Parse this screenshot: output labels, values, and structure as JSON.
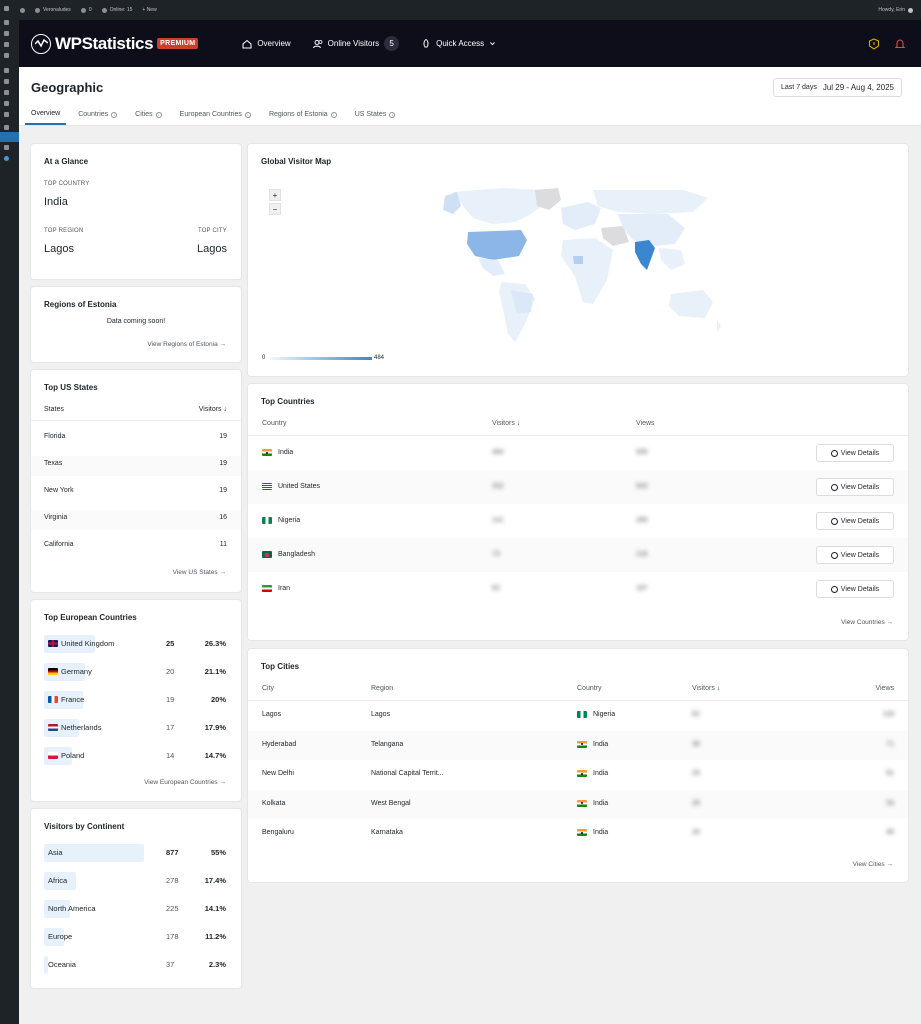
{
  "adminbar": {
    "site_name": "Veronaludes",
    "comments": "0",
    "online": "Online: 15",
    "new_label": "+ New",
    "howdy": "Howdy, Erin"
  },
  "header": {
    "logo_text": "WPStatistics",
    "premium": "PREMIUM",
    "nav": {
      "overview": "Overview",
      "online_visitors": "Online Visitors",
      "online_count": "5",
      "quick_access": "Quick Access"
    }
  },
  "page": {
    "title": "Geographic",
    "date_preset": "Last 7 days",
    "date_range": "Jul 29 - Aug 4, 2025",
    "tabs": [
      "Overview",
      "Countries",
      "Cities",
      "European Countries",
      "Regions of Estonia",
      "US States"
    ]
  },
  "glance": {
    "title": "At a Glance",
    "top_country_label": "TOP COUNTRY",
    "top_country": "India",
    "top_region_label": "TOP REGION",
    "top_region": "Lagos",
    "top_city_label": "TOP CITY",
    "top_city": "Lagos"
  },
  "estonia": {
    "title": "Regions of Estonia",
    "message": "Data coming soon!",
    "link": "View Regions of Estonia →"
  },
  "us_states": {
    "title": "Top US States",
    "col_state": "States",
    "col_visitors": "Visitors ↓",
    "rows": [
      {
        "name": "Florida",
        "value": "19"
      },
      {
        "name": "Texas",
        "value": "19"
      },
      {
        "name": "New York",
        "value": "19"
      },
      {
        "name": "Virginia",
        "value": "16"
      },
      {
        "name": "California",
        "value": "11"
      }
    ],
    "link": "View US States →"
  },
  "european": {
    "title": "Top European Countries",
    "rows": [
      {
        "name": "United Kingdom",
        "visitors": "25",
        "percent": "26.3%",
        "share": 0.263,
        "flag": "gb"
      },
      {
        "name": "Germany",
        "visitors": "20",
        "percent": "21.1%",
        "share": 0.211,
        "flag": "de"
      },
      {
        "name": "France",
        "visitors": "19",
        "percent": "20%",
        "share": 0.2,
        "flag": "fr"
      },
      {
        "name": "Netherlands",
        "visitors": "17",
        "percent": "17.9%",
        "share": 0.179,
        "flag": "nl"
      },
      {
        "name": "Poland",
        "visitors": "14",
        "percent": "14.7%",
        "share": 0.147,
        "flag": "pl"
      }
    ],
    "link": "View European Countries →"
  },
  "continents": {
    "title": "Visitors by Continent",
    "rows": [
      {
        "name": "Asia",
        "visitors": "877",
        "percent": "55%",
        "share": 0.55
      },
      {
        "name": "Africa",
        "visitors": "278",
        "percent": "17.4%",
        "share": 0.174
      },
      {
        "name": "North America",
        "visitors": "225",
        "percent": "14.1%",
        "share": 0.141
      },
      {
        "name": "Europe",
        "visitors": "178",
        "percent": "11.2%",
        "share": 0.112
      },
      {
        "name": "Oceania",
        "visitors": "37",
        "percent": "2.3%",
        "share": 0.023
      }
    ]
  },
  "map": {
    "title": "Global Visitor Map",
    "zoom_in": "+",
    "zoom_out": "−",
    "legend_min": "0",
    "legend_max": "484",
    "colors": {
      "low": "#e4eef9",
      "high": "#3a86d0",
      "nodata": "#dcdcde"
    }
  },
  "top_countries": {
    "title": "Top Countries",
    "col_country": "Country",
    "col_visitors": "Visitors ↓",
    "col_views": "Views",
    "button": "View Details",
    "rows": [
      {
        "name": "India",
        "visitors": "484",
        "views": "935",
        "flag": "in"
      },
      {
        "name": "United States",
        "visitors": "202",
        "views": "543",
        "flag": "us"
      },
      {
        "name": "Nigeria",
        "visitors": "141",
        "views": "285",
        "flag": "ng"
      },
      {
        "name": "Bangladesh",
        "visitors": "73",
        "views": "216",
        "flag": "bd"
      },
      {
        "name": "Iran",
        "visitors": "63",
        "views": "167",
        "flag": "ir"
      }
    ],
    "link": "View Countries →"
  },
  "top_cities": {
    "title": "Top Cities",
    "col_city": "City",
    "col_region": "Region",
    "col_country": "Country",
    "col_visitors": "Visitors ↓",
    "col_views": "Views",
    "rows": [
      {
        "city": "Lagos",
        "region": "Lagos",
        "country": "Nigeria",
        "flag": "ng",
        "visitors": "62",
        "views": "118"
      },
      {
        "city": "Hyderabad",
        "region": "Telangana",
        "country": "India",
        "flag": "in",
        "visitors": "38",
        "views": "71"
      },
      {
        "city": "New Delhi",
        "region": "National Capital Territ...",
        "country": "India",
        "flag": "in",
        "visitors": "29",
        "views": "61"
      },
      {
        "city": "Kolkata",
        "region": "West Bengal",
        "country": "India",
        "flag": "in",
        "visitors": "28",
        "views": "54"
      },
      {
        "city": "Bengaluru",
        "region": "Karnataka",
        "country": "India",
        "flag": "in",
        "visitors": "26",
        "views": "46"
      }
    ],
    "link": "View Cities →"
  }
}
